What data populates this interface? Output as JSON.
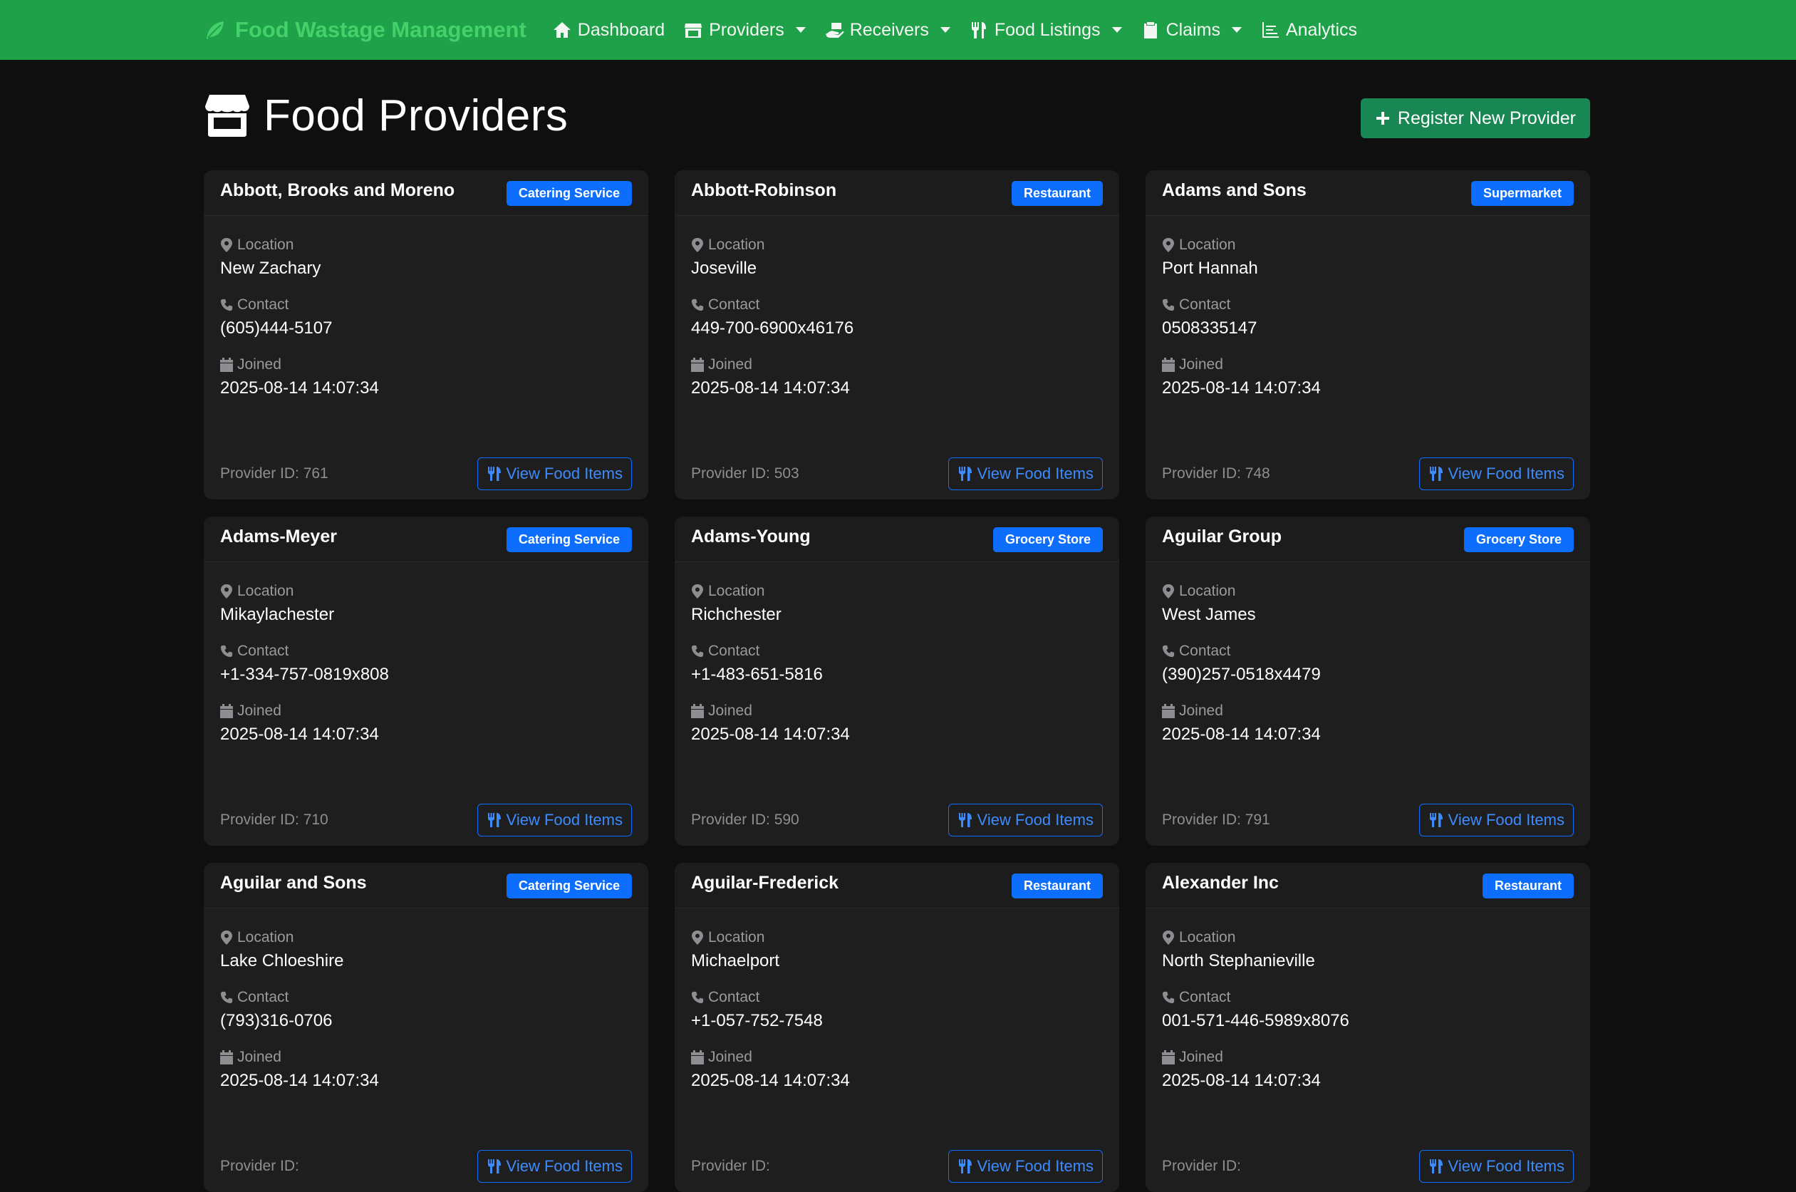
{
  "navbar": {
    "brand": "Food Wastage Management",
    "items": [
      {
        "label": "Dashboard",
        "icon": "home-icon",
        "dropdown": false
      },
      {
        "label": "Providers",
        "icon": "store-icon",
        "dropdown": true
      },
      {
        "label": "Receivers",
        "icon": "hand-holding-icon",
        "dropdown": true
      },
      {
        "label": "Food Listings",
        "icon": "utensils-icon",
        "dropdown": true
      },
      {
        "label": "Claims",
        "icon": "clipboard-icon",
        "dropdown": true
      },
      {
        "label": "Analytics",
        "icon": "chart-icon",
        "dropdown": false
      }
    ]
  },
  "page": {
    "title": "Food Providers",
    "register_label": "Register New Provider"
  },
  "labels": {
    "location": "Location",
    "contact": "Contact",
    "joined": "Joined",
    "provider_id_prefix": "Provider ID: ",
    "view_items": "View Food Items"
  },
  "providers": [
    {
      "name": "Abbott, Brooks and Moreno",
      "type": "Catering Service",
      "location": "New Zachary",
      "contact": "(605)444-5107",
      "joined": "2025-08-14 14:07:34",
      "id": "761"
    },
    {
      "name": "Abbott-Robinson",
      "type": "Restaurant",
      "location": "Joseville",
      "contact": "449-700-6900x46176",
      "joined": "2025-08-14 14:07:34",
      "id": "503"
    },
    {
      "name": "Adams and Sons",
      "type": "Supermarket",
      "location": "Port Hannah",
      "contact": "0508335147",
      "joined": "2025-08-14 14:07:34",
      "id": "748"
    },
    {
      "name": "Adams-Meyer",
      "type": "Catering Service",
      "location": "Mikaylachester",
      "contact": "+1-334-757-0819x808",
      "joined": "2025-08-14 14:07:34",
      "id": "710"
    },
    {
      "name": "Adams-Young",
      "type": "Grocery Store",
      "location": "Richchester",
      "contact": "+1-483-651-5816",
      "joined": "2025-08-14 14:07:34",
      "id": "590"
    },
    {
      "name": "Aguilar Group",
      "type": "Grocery Store",
      "location": "West James",
      "contact": "(390)257-0518x4479",
      "joined": "2025-08-14 14:07:34",
      "id": "791"
    },
    {
      "name": "Aguilar and Sons",
      "type": "Catering Service",
      "location": "Lake Chloeshire",
      "contact": "(793)316-0706",
      "joined": "2025-08-14 14:07:34",
      "id": ""
    },
    {
      "name": "Aguilar-Frederick",
      "type": "Restaurant",
      "location": "Michaelport",
      "contact": "+1-057-752-7548",
      "joined": "2025-08-14 14:07:34",
      "id": ""
    },
    {
      "name": "Alexander Inc",
      "type": "Restaurant",
      "location": "North Stephanieville",
      "contact": "001-571-446-5989x8076",
      "joined": "2025-08-14 14:07:34",
      "id": ""
    }
  ],
  "colors": {
    "navbar": "#1fa14a",
    "brand": "#45d16a",
    "badge": "#0d6efd",
    "register": "#198754",
    "card": "#1e1e1f",
    "background": "#0f0f10"
  }
}
